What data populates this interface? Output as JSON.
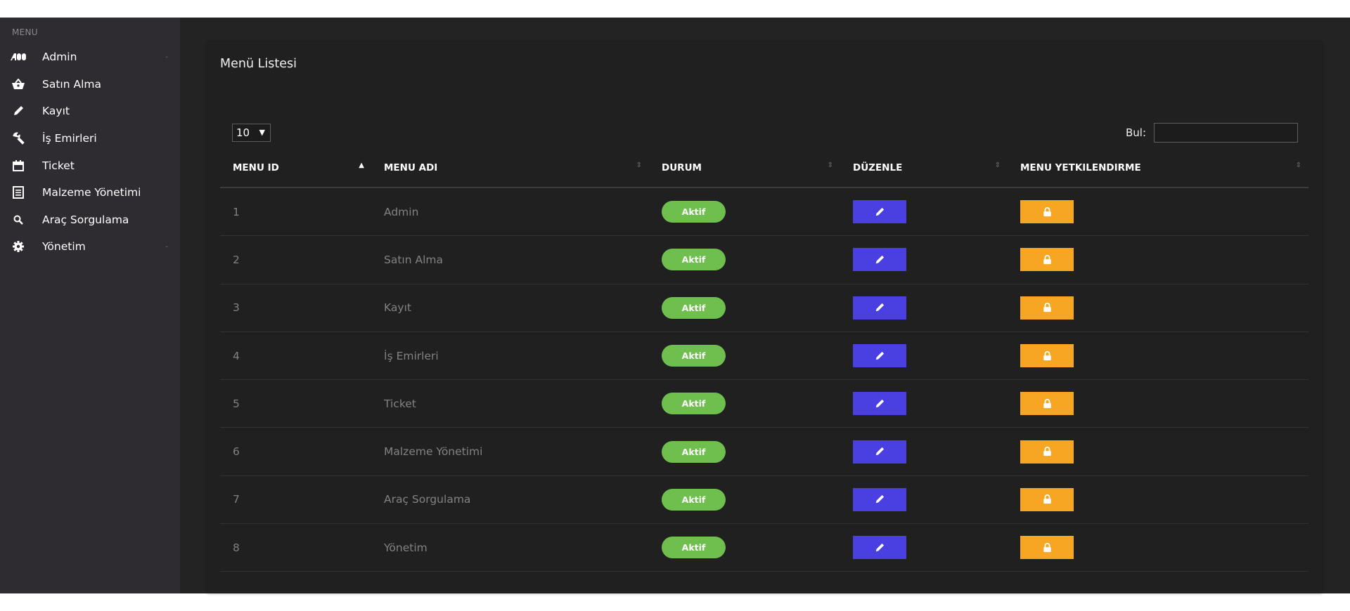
{
  "sidebar": {
    "title": "MENU",
    "items": [
      {
        "label": "Admin",
        "icon": "ad-icon",
        "expandable": true
      },
      {
        "label": "Satın Alma",
        "icon": "basket-icon",
        "expandable": false
      },
      {
        "label": "Kayıt",
        "icon": "pencil-icon",
        "expandable": false
      },
      {
        "label": "İş Emirleri",
        "icon": "wrench-icon",
        "expandable": false
      },
      {
        "label": "Ticket",
        "icon": "calendar-icon",
        "expandable": false
      },
      {
        "label": "Malzeme Yönetimi",
        "icon": "list-icon",
        "expandable": false
      },
      {
        "label": "Araç Sorgulama",
        "icon": "search-icon",
        "expandable": false
      },
      {
        "label": "Yönetim",
        "icon": "gear-icon",
        "expandable": true
      }
    ],
    "arrow": "-"
  },
  "panel": {
    "title": "Menü Listesi",
    "page_length": "10",
    "page_length_caret": "▼",
    "search_label": "Bul:",
    "search_value": ""
  },
  "table": {
    "columns": [
      "MENU ID",
      "MENU ADI",
      "DURUM",
      "DÜZENLE",
      "MENU YETKILENDIRME"
    ],
    "sort_active": "▲",
    "sort_neutral": "⇕",
    "rows": [
      {
        "id": "1",
        "name": "Admin",
        "status": "Aktif"
      },
      {
        "id": "2",
        "name": "Satın Alma",
        "status": "Aktif"
      },
      {
        "id": "3",
        "name": "Kayıt",
        "status": "Aktif"
      },
      {
        "id": "4",
        "name": "İş Emirleri",
        "status": "Aktif"
      },
      {
        "id": "5",
        "name": "Ticket",
        "status": "Aktif"
      },
      {
        "id": "6",
        "name": "Malzeme Yönetimi",
        "status": "Aktif"
      },
      {
        "id": "7",
        "name": "Araç Sorgulama",
        "status": "Aktif"
      },
      {
        "id": "8",
        "name": "Yönetim",
        "status": "Aktif"
      }
    ]
  },
  "colors": {
    "page_bg": "#232323",
    "sidebar_bg": "#2e2c31",
    "panel_bg": "#202020",
    "status_active": "#6fbf4f",
    "edit_button": "#4a3fe1",
    "permission_button": "#f6a623"
  }
}
